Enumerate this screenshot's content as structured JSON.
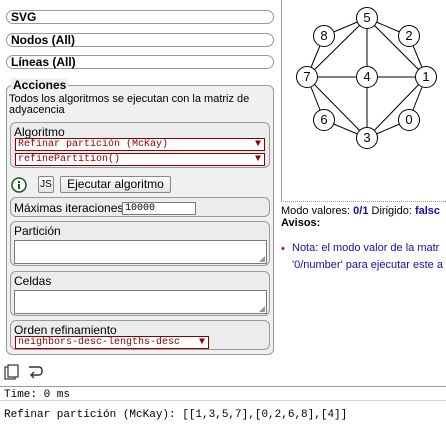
{
  "sections": {
    "svg": "SVG",
    "nodos": "Nodos (All)",
    "lineas": "Líneas (All)"
  },
  "acciones": {
    "legend": "Acciones",
    "description": "Todos los algoritmos se ejecutan con la matriz de adyacencia",
    "algoritmo_label": "Algoritmo",
    "algoritmo_select": "Refinar partición (McKay)",
    "method_select": "refinePartition()",
    "js_label": "JS",
    "run_button": "Ejecutar algoritmo",
    "max_iter_label": "Máximas iteraciones",
    "max_iter_value": "10000",
    "particion_label": "Partición",
    "celdas_label": "Celdas",
    "orden_label": "Orden refinamiento",
    "orden_select": "neighbors-desc-lengths-desc"
  },
  "graph": {
    "nodes": [
      "5",
      "8",
      "2",
      "7",
      "4",
      "1",
      "6",
      "3",
      "0"
    ]
  },
  "status": {
    "modo_label": "Modo valores:",
    "modo_value": "0/1",
    "dirigido_label": "Dirigido:",
    "dirigido_value": "falsc",
    "avisos_label": "Avisos:",
    "note_line1": "Nota: el modo valor de la matr",
    "note_line2": "'0/number' para ejecutar este a"
  },
  "output": {
    "time": "Time: 0 ms",
    "result": "Refinar partición (McKay): [[1,3,5,7],[0,2,6,8],[4]]"
  },
  "colors": {
    "select_text": "#8b0000",
    "note": "#1a0dab",
    "bullet": "#cc0000"
  }
}
